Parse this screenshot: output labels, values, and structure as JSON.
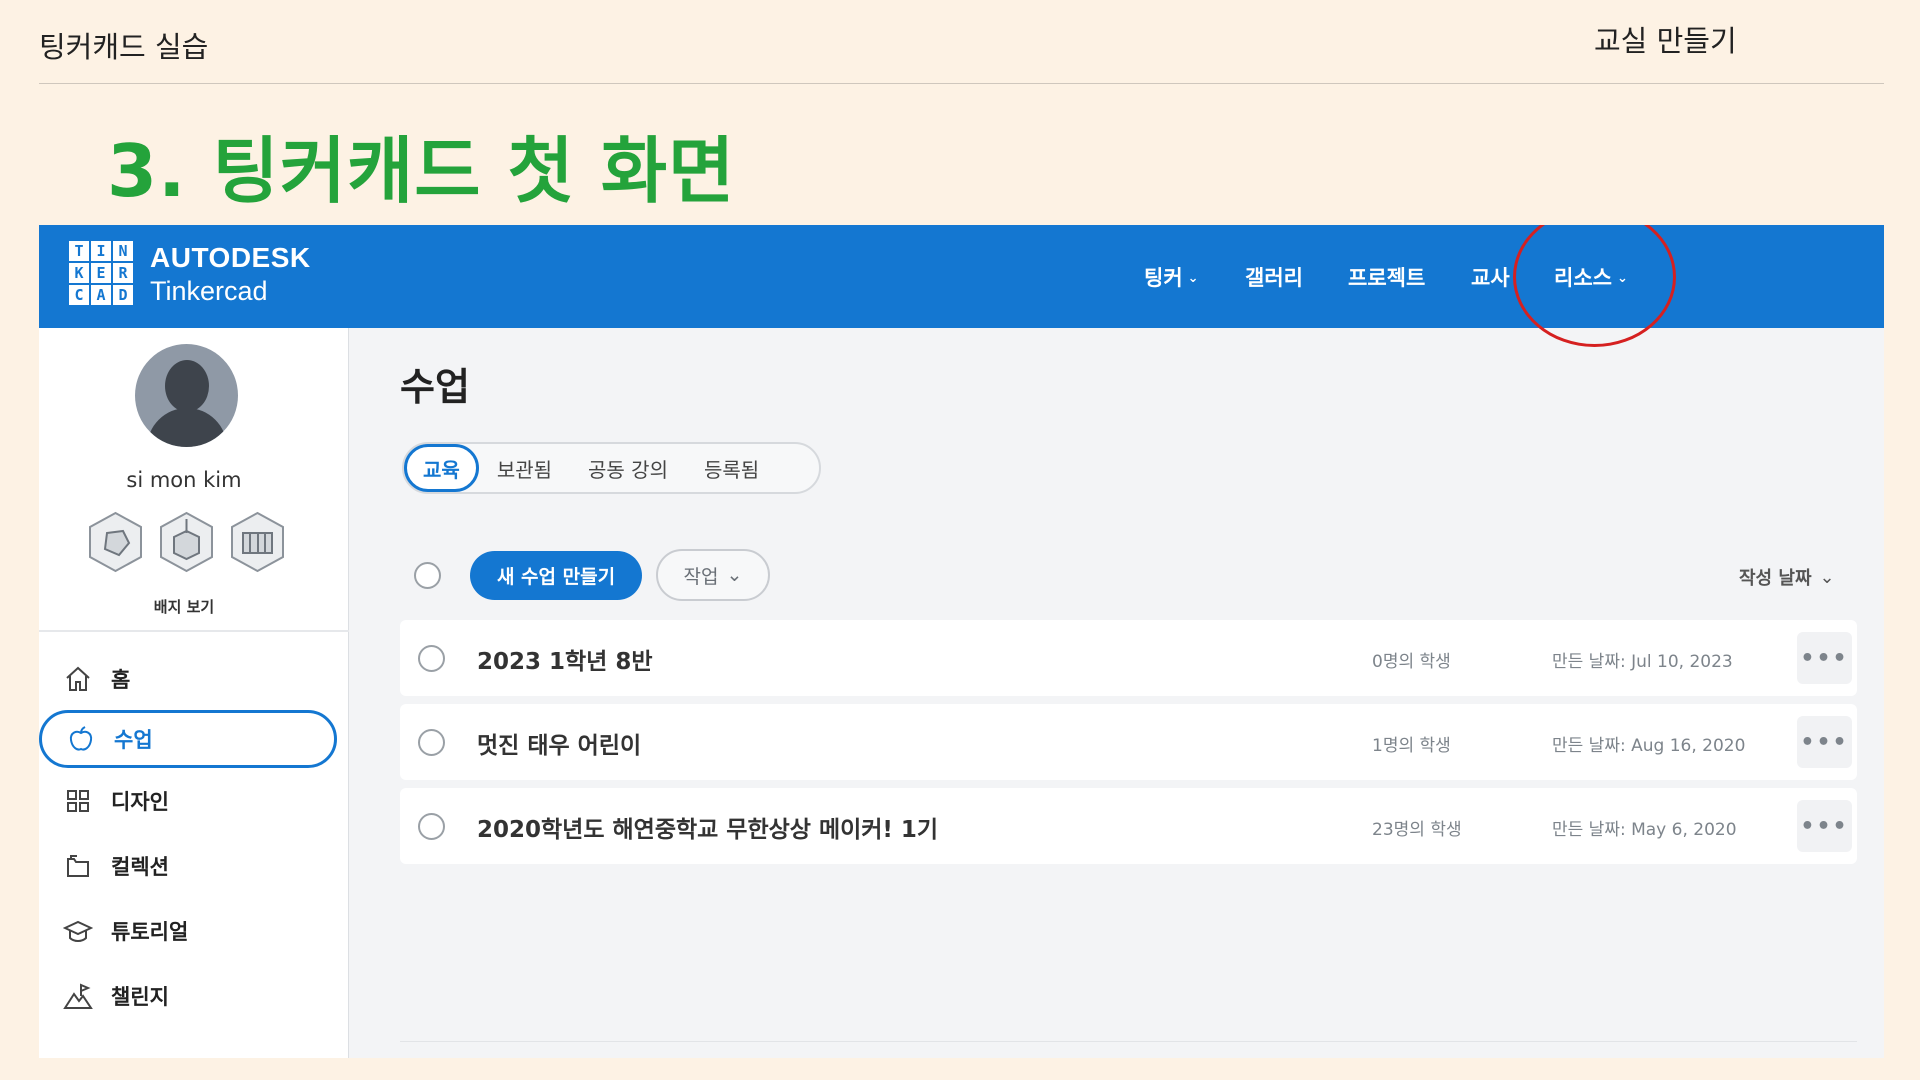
{
  "slide": {
    "title_left": "팅커캐드 실습",
    "title_right": "교실 만들기",
    "heading": "3. 팅커캐드 첫 화면"
  },
  "topbar": {
    "logo_letters": [
      "T",
      "I",
      "N",
      "K",
      "E",
      "R",
      "C",
      "A",
      "D"
    ],
    "brand_top": "AUTODESK",
    "brand_bottom": "Tinkercad",
    "nav": [
      {
        "label": "팅커",
        "has_dropdown": true
      },
      {
        "label": "갤러리",
        "has_dropdown": false
      },
      {
        "label": "프로젝트",
        "has_dropdown": false
      },
      {
        "label": "교사",
        "has_dropdown": false
      },
      {
        "label": "리소스",
        "has_dropdown": true
      }
    ],
    "highlight_color": "#d52020",
    "bar_color": "#1477d1"
  },
  "sidebar": {
    "username": "si mon kim",
    "badge_link": "배지 보기",
    "items": [
      {
        "label": "홈",
        "icon": "home-icon"
      },
      {
        "label": "수업",
        "icon": "apple-icon",
        "active": true
      },
      {
        "label": "디자인",
        "icon": "grid-icon"
      },
      {
        "label": "컬렉션",
        "icon": "folder-icon"
      },
      {
        "label": "튜토리얼",
        "icon": "graduation-cap-icon"
      },
      {
        "label": "챌린지",
        "icon": "mountain-flag-icon"
      }
    ]
  },
  "main": {
    "title": "수업",
    "tabs": [
      {
        "label": "교육",
        "active": true
      },
      {
        "label": "보관됨"
      },
      {
        "label": "공동 강의"
      },
      {
        "label": "등록됨"
      }
    ],
    "new_class_label": "새 수업 만들기",
    "actions_label": "작업",
    "sort_label": "작성 날짜",
    "classes": [
      {
        "name": "2023 1학년 8반",
        "students": "0명의 학생",
        "created": "만든 날짜: Jul 10, 2023"
      },
      {
        "name": "멋진 태우 어린이",
        "students": "1명의 학생",
        "created": "만든 날짜: Aug 16, 2020"
      },
      {
        "name": "2020학년도 해연중학교 무한상상 메이커! 1기",
        "students": "23명의 학생",
        "created": "만든 날짜: May 6, 2020"
      }
    ],
    "more_label": "•••"
  }
}
